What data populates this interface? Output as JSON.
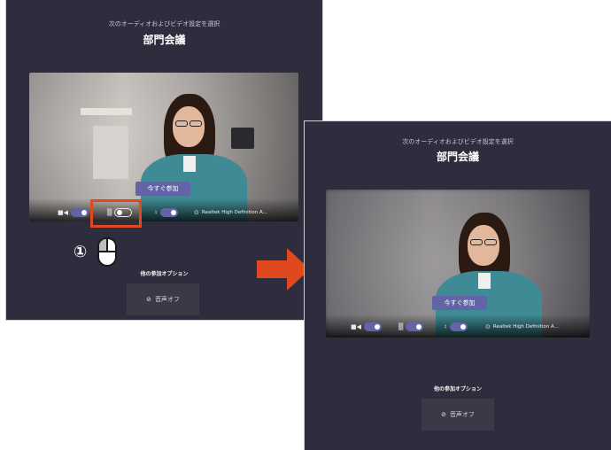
{
  "screens": {
    "before": {
      "subtitle": "次のオーディオおよびビデオ設定を選択",
      "title": "部門会議",
      "join_button": "今すぐ参加",
      "device_label": "Realtek High Definition A...",
      "other_options": "他の参加オプション",
      "audio_off": "音声オフ"
    },
    "after": {
      "subtitle": "次のオーディオおよびビデオ設定を選択",
      "title": "部門会議",
      "join_button": "今すぐ参加",
      "device_label": "Realtek High Definition A...",
      "other_options": "他の参加オプション",
      "audio_off": "音声オフ"
    }
  },
  "annotation": {
    "step": "①",
    "highlight_color": "#e0491e",
    "arrow_color": "#e0491e"
  },
  "icons": {
    "camera": "camera-icon",
    "blur": "background-blur-icon",
    "mic": "microphone-icon",
    "settings": "device-settings-icon",
    "speaker_off": "speaker-off-icon",
    "mouse": "mouse-icon"
  },
  "colors": {
    "panel_bg": "#2e2d3d",
    "accent": "#6264a7"
  },
  "toggles_before": {
    "camera": true,
    "blur": false,
    "mic": true
  },
  "toggles_after": {
    "camera": true,
    "blur": true,
    "mic": true
  }
}
